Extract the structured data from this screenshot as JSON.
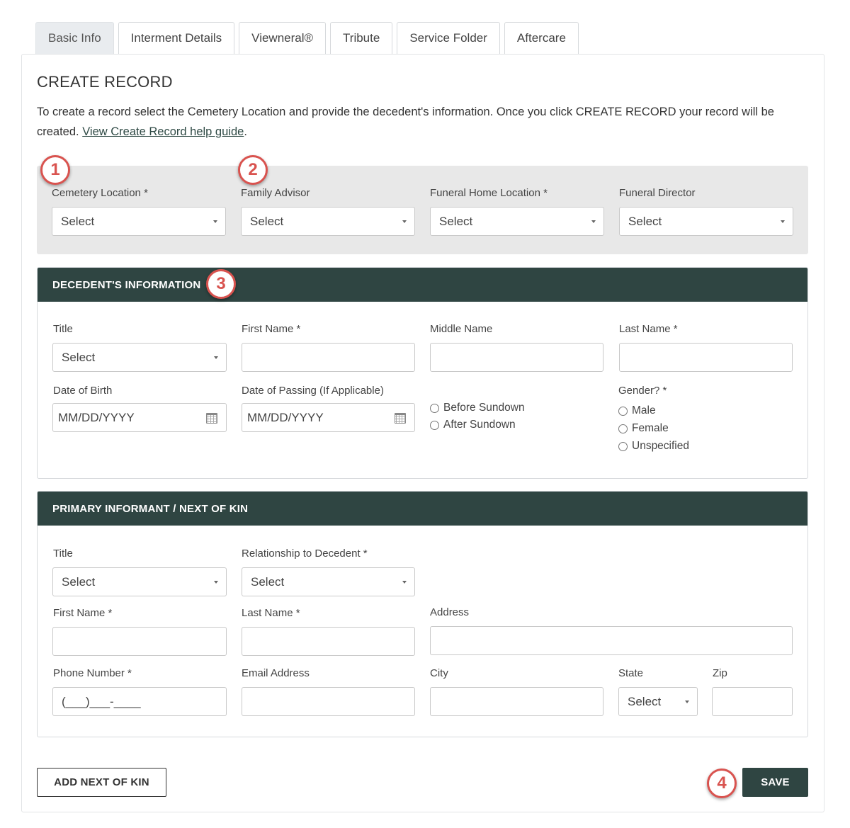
{
  "tabs": [
    "Basic Info",
    "Interment Details",
    "Viewneral®",
    "Tribute",
    "Service Folder",
    "Aftercare"
  ],
  "page_title": "CREATE RECORD",
  "intro": {
    "text": "To create a record select the Cemetery Location and provide the decedent's information. Once you click CREATE RECORD your record will be created. ",
    "link": "View Create Record help guide",
    "trailing": "."
  },
  "location_box": {
    "cemetery_location": {
      "label": "Cemetery Location *",
      "value": "Select"
    },
    "family_advisor": {
      "label": "Family Advisor",
      "value": "Select"
    },
    "funeral_home_location": {
      "label": "Funeral Home Location *",
      "value": "Select"
    },
    "funeral_director": {
      "label": "Funeral Director",
      "value": "Select"
    }
  },
  "decedent": {
    "header": "DECEDENT'S INFORMATION",
    "title": {
      "label": "Title",
      "value": "Select"
    },
    "first_name": {
      "label": "First Name *",
      "value": ""
    },
    "middle_name": {
      "label": "Middle Name",
      "value": ""
    },
    "last_name": {
      "label": "Last Name *",
      "value": ""
    },
    "dob": {
      "label": "Date of Birth",
      "placeholder": "MM/DD/YYYY"
    },
    "dop": {
      "label": "Date of Passing (If Applicable)",
      "placeholder": "MM/DD/YYYY"
    },
    "sundown": [
      "Before Sundown",
      "After Sundown"
    ],
    "gender": {
      "label": "Gender? *",
      "options": [
        "Male",
        "Female",
        "Unspecified"
      ]
    }
  },
  "informant": {
    "header": "PRIMARY INFORMANT / NEXT OF KIN",
    "title": {
      "label": "Title",
      "value": "Select"
    },
    "relationship": {
      "label": "Relationship to Decedent *",
      "value": "Select"
    },
    "first_name": {
      "label": "First Name *",
      "value": ""
    },
    "last_name": {
      "label": "Last Name *",
      "value": ""
    },
    "address": {
      "label": "Address",
      "value": ""
    },
    "phone": {
      "label": "Phone Number *",
      "placeholder": "(___)___-____"
    },
    "email": {
      "label": "Email Address",
      "value": ""
    },
    "city": {
      "label": "City",
      "value": ""
    },
    "state": {
      "label": "State",
      "value": "Select"
    },
    "zip": {
      "label": "Zip",
      "value": ""
    }
  },
  "buttons": {
    "add_next_of_kin": "ADD NEXT OF KIN",
    "save": "SAVE"
  },
  "badges": [
    "1",
    "2",
    "3",
    "4"
  ],
  "colors": {
    "header_bg": "#2f4542",
    "badge": "#d9534f",
    "grey_box": "#e8e8e8"
  }
}
